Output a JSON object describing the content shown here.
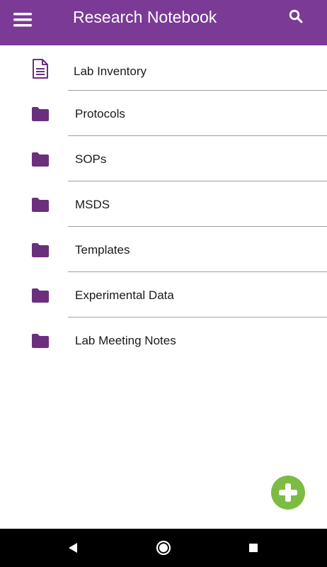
{
  "app": {
    "title": "Research Notebook"
  },
  "colors": {
    "header": "#7b3a96",
    "folder": "#6b2f7e",
    "fab": "#7cbc42",
    "navbar": "#000000"
  },
  "toolbar": {
    "menu_icon": "hamburger-menu-icon",
    "search_icon": "search-icon"
  },
  "items": [
    {
      "label": "Lab Inventory",
      "icon": "document-icon"
    },
    {
      "label": "Protocols",
      "icon": "folder-icon"
    },
    {
      "label": "SOPs",
      "icon": "folder-icon"
    },
    {
      "label": "MSDS",
      "icon": "folder-icon"
    },
    {
      "label": "Templates",
      "icon": "folder-icon"
    },
    {
      "label": "Experimental Data",
      "icon": "folder-icon"
    },
    {
      "label": "Lab Meeting Notes",
      "icon": "folder-icon"
    }
  ],
  "fab": {
    "icon": "plus-icon"
  },
  "system_nav": {
    "back_icon": "back-triangle-icon",
    "home_icon": "home-circle-icon",
    "recents_icon": "recents-square-icon"
  }
}
